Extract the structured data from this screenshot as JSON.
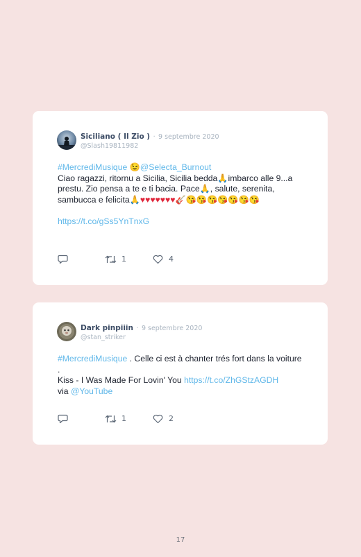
{
  "tweets": [
    {
      "author": "Siciliano ( Il Zio )",
      "separator": "·",
      "date": "9 septembre 2020",
      "handle": "@Slash19811982",
      "hashtag": "#MercrediMusique",
      "emoji_wink": "😉",
      "mention": "@Selecta_Burnout",
      "text_part1": "Ciao ragazzi, ritornu a Sicilia, Sicilia bedda",
      "emoji_pray_1": "🙏",
      "text_part2": "imbarco alle 9...a prestu. Zio pensa a te e ti bacia. Pace",
      "emoji_pray_2": "🙏",
      "text_part3": ", salute, serenita, sambucca e felicita",
      "emoji_pray_3": "🙏",
      "hearts": "♥♥♥♥♥♥♥",
      "emoji_guitar": "🎸",
      "emoji_kisses": "😘😘😘😘😘😘😘",
      "link": "https://t.co/gSs5YnTnxG",
      "retweets": "1",
      "likes": "4"
    },
    {
      "author": "Dark pinpiiin",
      "separator": "·",
      "date": "9 septembre 2020",
      "handle": "@stan_striker",
      "hashtag": "#MercrediMusique",
      "text_part1": " . Celle ci est à chanter trés fort dans la voiture .",
      "text_part2": "Kiss - I Was Made For Lovin' You ",
      "link": "https://t.co/ZhGStzAGDH",
      "text_part3": "via ",
      "mention": "@YouTube",
      "retweets": "1",
      "likes": "2"
    }
  ],
  "page_number": "17",
  "icons": {
    "reply": "reply-icon",
    "retweet": "retweet-icon",
    "like": "heart-icon"
  },
  "colors": {
    "background": "#f6e3e2",
    "card": "#ffffff",
    "link": "#5fb7e9",
    "name": "#3d4d66",
    "muted": "#a9b4c0"
  }
}
